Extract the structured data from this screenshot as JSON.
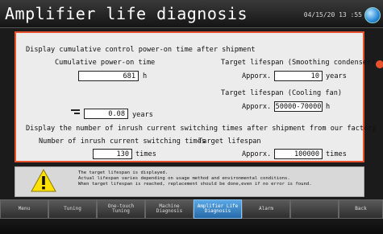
{
  "header": {
    "title": "Amplifier life diagnosis",
    "datetime": "04/15/20 13 :55"
  },
  "section1": {
    "heading": "Display cumulative control power-on time after shipment",
    "cum_label": "Cumulative power-on time",
    "hours_value": "681",
    "hours_unit": "h",
    "years_value": "0.08",
    "years_unit": "years",
    "cond_label": "Target lifespan (Smoothing condenser)",
    "cond_approx": "Apporx.",
    "cond_value": "10",
    "cond_unit": "years",
    "fan_label": "Target lifespan (Cooling fan)",
    "fan_approx": "Apporx.",
    "fan_value": "50000-70000",
    "fan_unit": "h"
  },
  "section2": {
    "heading": "Display the number of inrush current switching times after shipment from our factory",
    "count_label": "Number of inrush current switching times",
    "count_value": "130",
    "count_unit": "times",
    "target_label": "Target lifespan",
    "target_approx": "Apporx.",
    "target_value": "100000",
    "target_unit": "times"
  },
  "message": {
    "line1": "The target lifespan is displayed.",
    "line2": "Actual lifespan varies depending on usage method and environmental conditions.",
    "line3": "When target lifespan is reached, replacement should be done,even if no error is found."
  },
  "tabs": [
    {
      "label": "Menu"
    },
    {
      "label": "Tuning"
    },
    {
      "label": "One-touch Tuning"
    },
    {
      "label": "Machine Diagnosis"
    },
    {
      "label": "Amplifier Life Diagnosis",
      "active": true
    },
    {
      "label": "Alarm"
    },
    {
      "label": ""
    },
    {
      "label": "Back"
    }
  ],
  "colors": {
    "accent": "#e9512c",
    "active_tab": "#3a8ad0"
  },
  "icons": [
    "globe-icon",
    "approx-icon",
    "warning-icon"
  ]
}
